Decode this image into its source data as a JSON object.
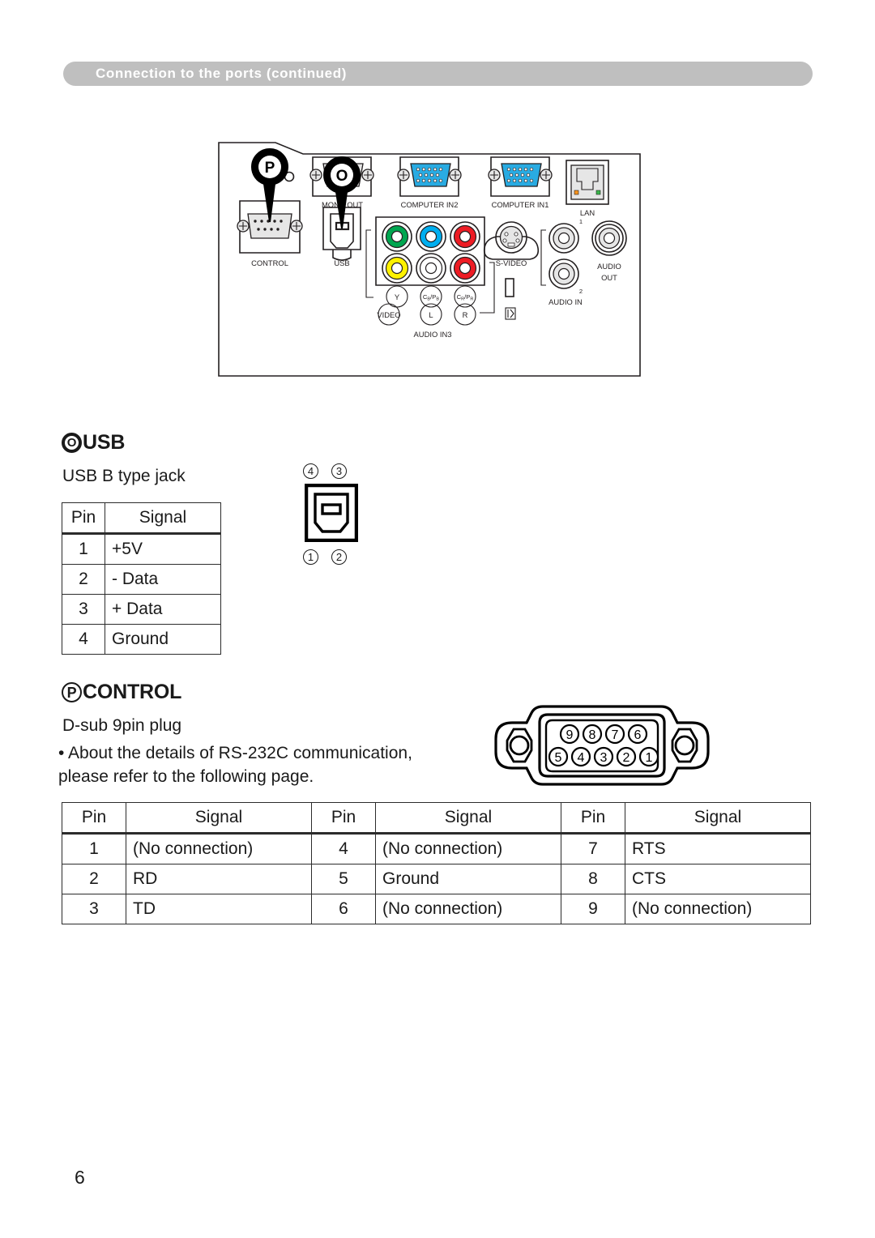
{
  "header": {
    "title": "Connection to the ports (continued)",
    "bar_color": "#bfbfbf",
    "text_color": "#ffffff"
  },
  "port_panel": {
    "callouts": [
      {
        "letter": "P",
        "target": "CONTROL"
      },
      {
        "letter": "O",
        "target": "USB"
      }
    ],
    "labels": [
      "CONTROL",
      "USB",
      "MONITOR OUT",
      "COMPUTER IN2",
      "COMPUTER IN1",
      "LAN",
      "S-VIDEO",
      "AUDIO IN",
      "AUDIO OUT",
      "AUDIO IN3",
      "VIDEO",
      "Y",
      "CB/PB",
      "CR/PR",
      "L",
      "R",
      "1",
      "2"
    ],
    "monitor_out_label": "MONITOR OUT",
    "monitor_out_text_a": "MON",
    "monitor_out_text_b": "OUT",
    "computer_in2_label": "COMPUTER IN2",
    "computer_in1_label": "COMPUTER IN1",
    "lan_label": "LAN",
    "control_label": "CONTROL",
    "usb_label": "USB",
    "svideo_label": "S-VIDEO",
    "audio_in_label": "AUDIO IN",
    "audio_out_label_a": "AUDIO",
    "audio_out_label_b": "OUT",
    "audio_in3_label": "AUDIO IN3",
    "video_label": "VIDEO",
    "y_label": "Y",
    "cbpb_label_a": "C",
    "cbpb_label_b": "B/P",
    "cbpb_label_c": "B",
    "crpr_label_a": "C",
    "crpr_label_b": "R/P",
    "crpr_label_c": "R",
    "l_label": "L",
    "r_label": "R",
    "audio_num_1": "1",
    "audio_num_2": "2",
    "colors": {
      "component_y": "#00a650",
      "component_cb": "#00aeef",
      "component_cr": "#ed1c24",
      "video_yellow": "#fff200",
      "audio_l_white": "#ffffff",
      "audio_r_red": "#ed1c24",
      "vga_blue": "#29abe2",
      "monitor_gray": "#b3b3b3",
      "panel_white": "#ffffff"
    }
  },
  "usb_section": {
    "symbol": "O",
    "heading": "USB",
    "subtitle": "USB B type jack",
    "table": {
      "headers": [
        "Pin",
        "Signal"
      ],
      "rows": [
        [
          "1",
          "+5V"
        ],
        [
          "2",
          "- Data"
        ],
        [
          "3",
          "+ Data"
        ],
        [
          "4",
          "Ground"
        ]
      ]
    },
    "pinout": {
      "top_pins": [
        "4",
        "3"
      ],
      "bottom_pins": [
        "1",
        "2"
      ]
    }
  },
  "control_section": {
    "symbol": "P",
    "heading": "CONTROL",
    "subtitle": "D-sub 9pin plug",
    "note_line1": "• About the details of RS-232C communication,",
    "note_line2": "please refer to the following page.",
    "table": {
      "headers": [
        "Pin",
        "Signal",
        "Pin",
        "Signal",
        "Pin",
        "Signal"
      ],
      "rows": [
        [
          "1",
          "(No connection)",
          "4",
          "(No connection)",
          "7",
          "RTS"
        ],
        [
          "2",
          "RD",
          "5",
          "Ground",
          "8",
          "CTS"
        ],
        [
          "3",
          "TD",
          "6",
          "(No connection)",
          "9",
          "(No connection)"
        ]
      ]
    },
    "pinout": {
      "top_row": [
        "9",
        "8",
        "7",
        "6"
      ],
      "bottom_row": [
        "5",
        "4",
        "3",
        "2",
        "1"
      ]
    }
  },
  "footer": {
    "page_number": "6"
  }
}
